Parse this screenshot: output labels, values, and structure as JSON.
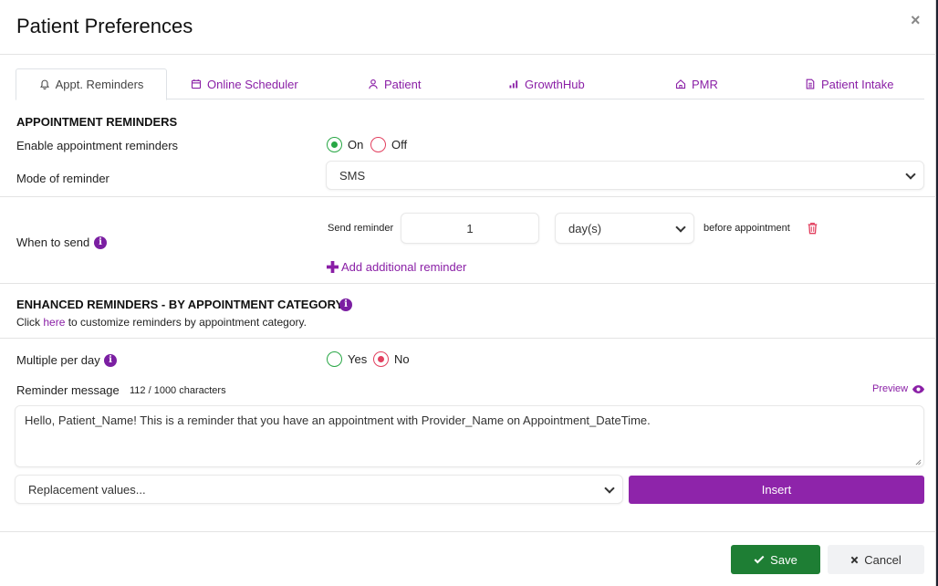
{
  "modal": {
    "title": "Patient Preferences",
    "close_glyph": "×"
  },
  "tabs": [
    {
      "label": "Appt. Reminders",
      "icon": "bell-icon"
    },
    {
      "label": "Online Scheduler",
      "icon": "calendar-icon"
    },
    {
      "label": "Patient",
      "icon": "user-icon"
    },
    {
      "label": "GrowthHub",
      "icon": "bar-chart-icon"
    },
    {
      "label": "PMR",
      "icon": "home-icon"
    },
    {
      "label": "Patient Intake",
      "icon": "document-icon"
    }
  ],
  "reminders": {
    "heading": "APPOINTMENT REMINDERS",
    "enable_label": "Enable appointment reminders",
    "on_label": "On",
    "off_label": "Off",
    "enabled": "On",
    "mode_label": "Mode of reminder",
    "mode_value": "SMS",
    "when_label": "When to send",
    "send_reminder_label": "Send reminder",
    "send_value": "1",
    "unit_value": "day(s)",
    "before_label": "before appointment",
    "add_label": "Add additional reminder"
  },
  "enhanced": {
    "heading": "ENHANCED REMINDERS - BY APPOINTMENT CATEGORY",
    "click_text": "Click",
    "here_link": "here",
    "rest_text": "to customize reminders by appointment category."
  },
  "multiple": {
    "label": "Multiple per day",
    "yes_label": "Yes",
    "no_label": "No",
    "selected": "No"
  },
  "message": {
    "label": "Reminder message",
    "counter": "112 / 1000 characters",
    "preview_label": "Preview",
    "text": "Hello, Patient_Name! This is a reminder that you have an appointment with Provider_Name on Appointment_DateTime.",
    "replacement_placeholder": "Replacement values...",
    "insert_label": "Insert"
  },
  "footer": {
    "save_label": "Save",
    "cancel_label": "Cancel"
  },
  "colors": {
    "accent": "#8e24aa",
    "save": "#1e7e34",
    "on_radio": "#28a745",
    "off_radio": "#e2405f"
  }
}
